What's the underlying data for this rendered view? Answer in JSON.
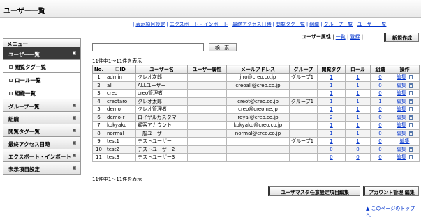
{
  "header": {
    "title": "ユーザー一覧"
  },
  "top_links": [
    "表示項目設定",
    "エクスポート・インポート",
    "最終アクセス日時",
    "閲覧タグ一覧",
    "組織",
    "グループ一覧",
    "ユーザー一覧"
  ],
  "sidebar": {
    "menu_title": "メニュー",
    "items": [
      {
        "label": "ユーザー一覧",
        "active": true
      },
      {
        "label": "閲覧タグ一覧",
        "sub": true
      },
      {
        "label": "ロール一覧",
        "sub": true
      },
      {
        "label": "組織一覧",
        "sub": true
      },
      {
        "label": "グループ一覧"
      },
      {
        "label": "組織"
      },
      {
        "label": "閲覧タグ一覧"
      },
      {
        "label": "最終アクセス日時"
      },
      {
        "label": "エクスポート・インポート"
      },
      {
        "label": "表示項目設定"
      }
    ]
  },
  "tabs": {
    "current": "ユーザー属性",
    "list": "一覧",
    "register": "登録",
    "separator": "|"
  },
  "new_button": "新規作成",
  "search": {
    "placeholder": "",
    "value": "",
    "button": "検 索"
  },
  "count_text": "11件中1～11件を表示",
  "table": {
    "headers": [
      "No.",
      "ID",
      "ユーザー名",
      "ユーザー属性",
      "メールアドレス",
      "グループ",
      "閲覧タグ",
      "ロール",
      "組織",
      "操作"
    ],
    "id_checkbox_glyph": "☐",
    "edit_label": "編集",
    "rows": [
      [
        "1",
        "admin",
        "クレオ次郎",
        "",
        "jiro@creo.co.jp",
        "グループ1",
        "1",
        "1",
        "0"
      ],
      [
        "2",
        "all",
        "ALLユーザー",
        "",
        "creoall@creo.co.jp",
        "",
        "1",
        "1",
        "0"
      ],
      [
        "3",
        "creo",
        "creo管理者",
        "",
        "",
        "",
        "1",
        "1",
        "0"
      ],
      [
        "4",
        "creotaro",
        "クレオ太郎",
        "",
        "creot@creo.co.jp",
        "グループ1",
        "1",
        "1",
        "1"
      ],
      [
        "5",
        "demo",
        "クレオ管理者",
        "",
        "creo@creo.ne.jp",
        "",
        "1",
        "1",
        "0"
      ],
      [
        "6",
        "demo-r",
        "ロイヤルカスタマー",
        "",
        "royal@creo.co.jp",
        "",
        "2",
        "1",
        "0"
      ],
      [
        "7",
        "kokyaku",
        "顧客アカウント",
        "",
        "kokyaku@creo.co.jp",
        "",
        "1",
        "1",
        "0"
      ],
      [
        "8",
        "normal",
        "一般ユーザー",
        "",
        "normal@creo.co.jp",
        "",
        "1",
        "1",
        "0"
      ],
      [
        "9",
        "test1",
        "テストユーザー",
        "",
        "",
        "グループ1",
        "1",
        "1",
        "0"
      ],
      [
        "10",
        "test2",
        "テストユーザー2",
        "",
        "",
        "",
        "0",
        "0",
        "0"
      ],
      [
        "11",
        "test3",
        "テストユーザー3",
        "",
        "",
        "",
        "0",
        "0",
        "0"
      ]
    ],
    "trash_rows": [
      true,
      true,
      true,
      true,
      true,
      true,
      true,
      true,
      false,
      true,
      true
    ]
  },
  "buttons": {
    "custom": "ユーザマスタ任意設定項目編集",
    "account": "アカウント管理 編集"
  },
  "back_to_top": {
    "arrow": "▲",
    "label": "このページのトップへ"
  }
}
